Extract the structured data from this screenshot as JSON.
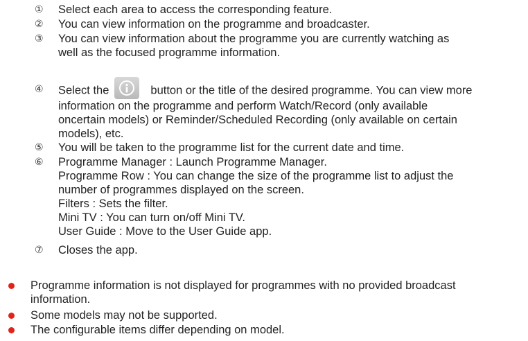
{
  "steps": [
    {
      "num": "①",
      "lines": [
        "Select each area to access the corresponding feature."
      ]
    },
    {
      "num": "②",
      "lines": [
        "You can view information on the programme and broadcaster."
      ]
    },
    {
      "num": "③",
      "lines": [
        "You can view information about the programme you are currently watching as",
        "well as the focused programme information."
      ]
    },
    {
      "num": "④",
      "before_icon": "Select the",
      "after_icon": "button or the title of the desired programme. You can view more",
      "lines": [
        "information on the programme and perform Watch/Record (only available",
        "oncertain models) or Reminder/Scheduled Recording (only available on certain",
        "models), etc."
      ]
    },
    {
      "num": "⑤",
      "lines": [
        "You will be taken to the programme list for the current date and time."
      ]
    },
    {
      "num": "⑥",
      "lines": [
        "Programme Manager : Launch Programme Manager.",
        "Programme Row : You can change the size of the programme list to adjust the",
        "number of programmes displayed on the screen.",
        "Filters : Sets the filter.",
        "Mini TV : You can turn on/off Mini TV.",
        "User Guide : Move to the User Guide app."
      ]
    },
    {
      "num": "⑦",
      "lines": [
        "Closes the app."
      ]
    }
  ],
  "notes": [
    {
      "lines": [
        "Programme information is not displayed for programmes with no provided broadcast",
        "information."
      ]
    },
    {
      "lines": [
        "Some models may not be supported."
      ]
    },
    {
      "lines": [
        "The configurable items differ depending on model."
      ]
    }
  ],
  "icons": {
    "info_button": "info-icon"
  },
  "colors": {
    "bullet": "#e2231a",
    "info_button": "#c4c4c4"
  }
}
